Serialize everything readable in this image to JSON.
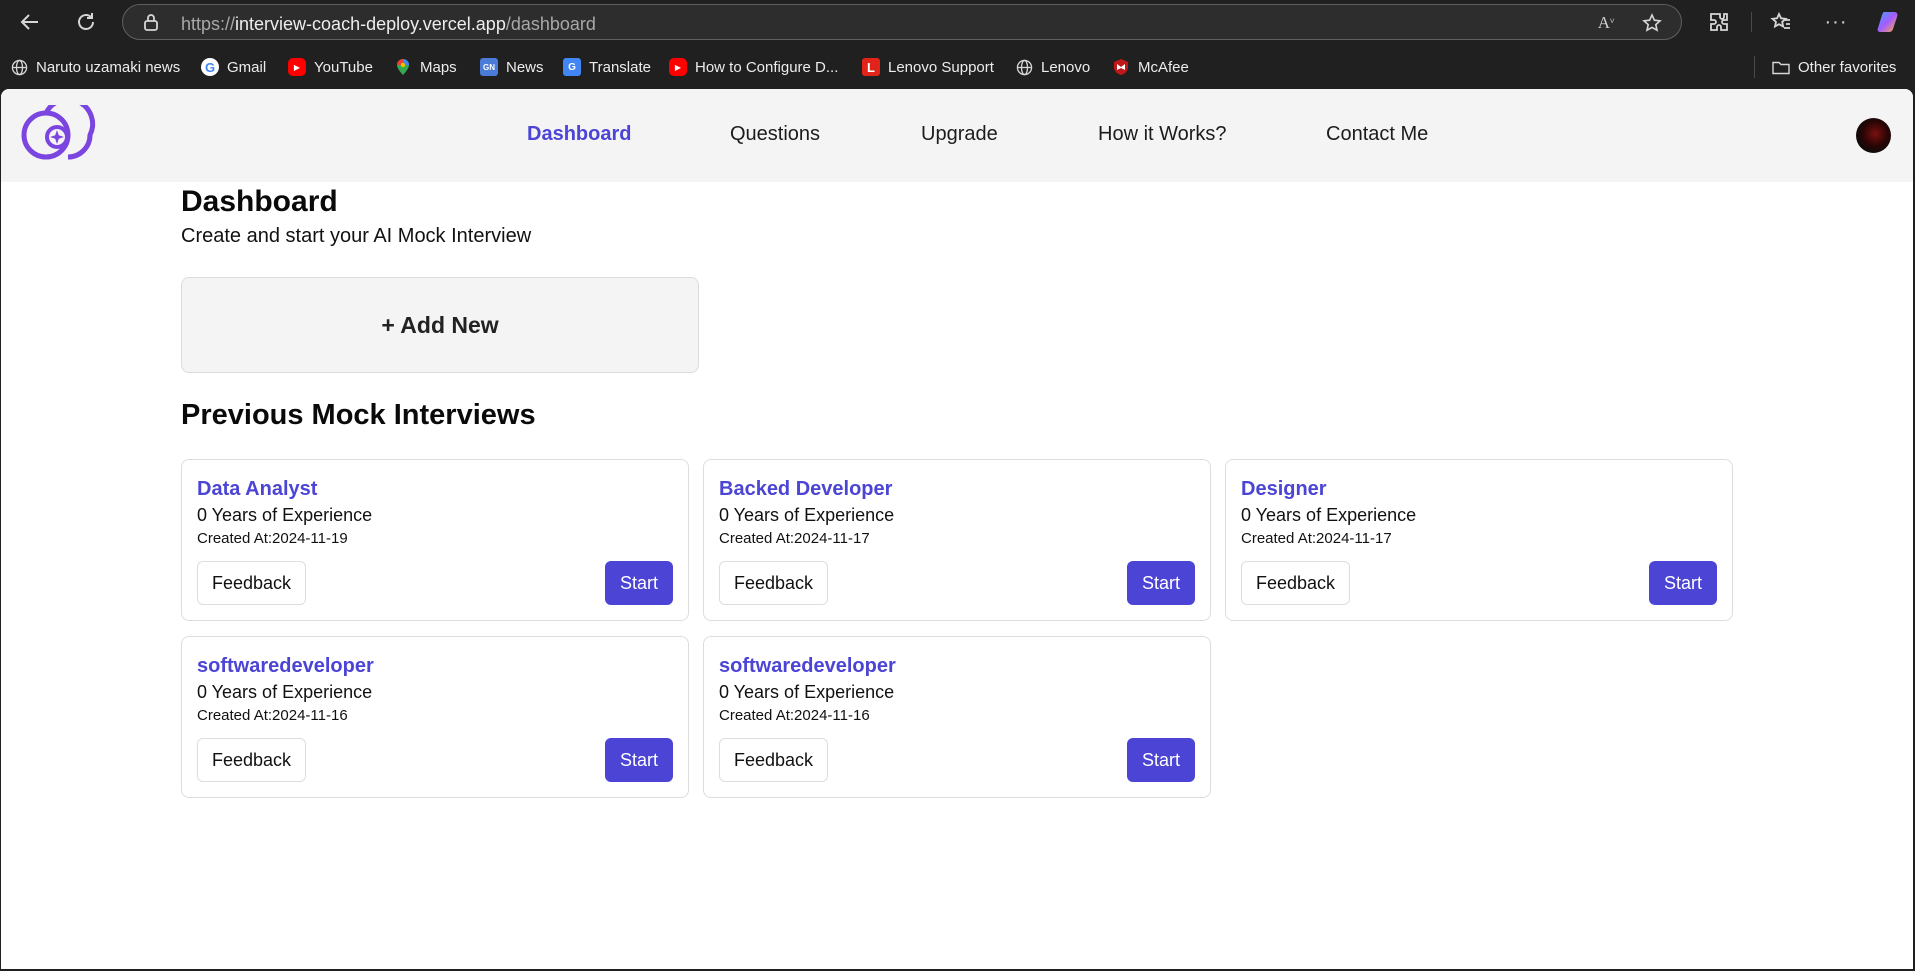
{
  "browser": {
    "url_protocol": "https://",
    "url_host": "interview-coach-deploy.vercel.app",
    "url_path": "/dashboard",
    "bookmarks": [
      {
        "label": "Naruto uzamaki news",
        "icon": "globe-icon"
      },
      {
        "label": "Gmail",
        "icon": "google-icon"
      },
      {
        "label": "YouTube",
        "icon": "youtube-icon"
      },
      {
        "label": "Maps",
        "icon": "maps-pin-icon"
      },
      {
        "label": "News",
        "icon": "news-icon"
      },
      {
        "label": "Translate",
        "icon": "translate-icon"
      },
      {
        "label": "How to Configure D...",
        "icon": "youtube-icon"
      },
      {
        "label": "Lenovo Support",
        "icon": "lenovo-l-icon"
      },
      {
        "label": "Lenovo",
        "icon": "globe-icon"
      },
      {
        "label": "McAfee",
        "icon": "mcafee-shield-icon"
      }
    ],
    "other_favorites": "Other favorites"
  },
  "nav": {
    "items": [
      {
        "label": "Dashboard",
        "active": true
      },
      {
        "label": "Questions",
        "active": false
      },
      {
        "label": "Upgrade",
        "active": false
      },
      {
        "label": "How it Works?",
        "active": false
      },
      {
        "label": "Contact Me",
        "active": false
      }
    ]
  },
  "dashboard": {
    "title": "Dashboard",
    "subtitle": "Create and start your AI Mock Interview",
    "add_new": "+ Add New",
    "previous_title": "Previous Mock Interviews",
    "interviews": [
      {
        "role": "Data Analyst",
        "experience": "0 Years of Experience",
        "created": "Created At:2024-11-19",
        "feedback": "Feedback",
        "start": "Start"
      },
      {
        "role": "Backed Developer",
        "experience": "0 Years of Experience",
        "created": "Created At:2024-11-17",
        "feedback": "Feedback",
        "start": "Start"
      },
      {
        "role": "Designer",
        "experience": "0 Years of Experience",
        "created": "Created At:2024-11-17",
        "feedback": "Feedback",
        "start": "Start"
      },
      {
        "role": "softwaredeveloper",
        "experience": "0 Years of Experience",
        "created": "Created At:2024-11-16",
        "feedback": "Feedback",
        "start": "Start"
      },
      {
        "role": "softwaredeveloper",
        "experience": "0 Years of Experience",
        "created": "Created At:2024-11-16",
        "feedback": "Feedback",
        "start": "Start"
      }
    ]
  },
  "colors": {
    "accent": "#4b44d4",
    "header_bg": "#f4f4f5",
    "browser_bg": "#202020"
  }
}
